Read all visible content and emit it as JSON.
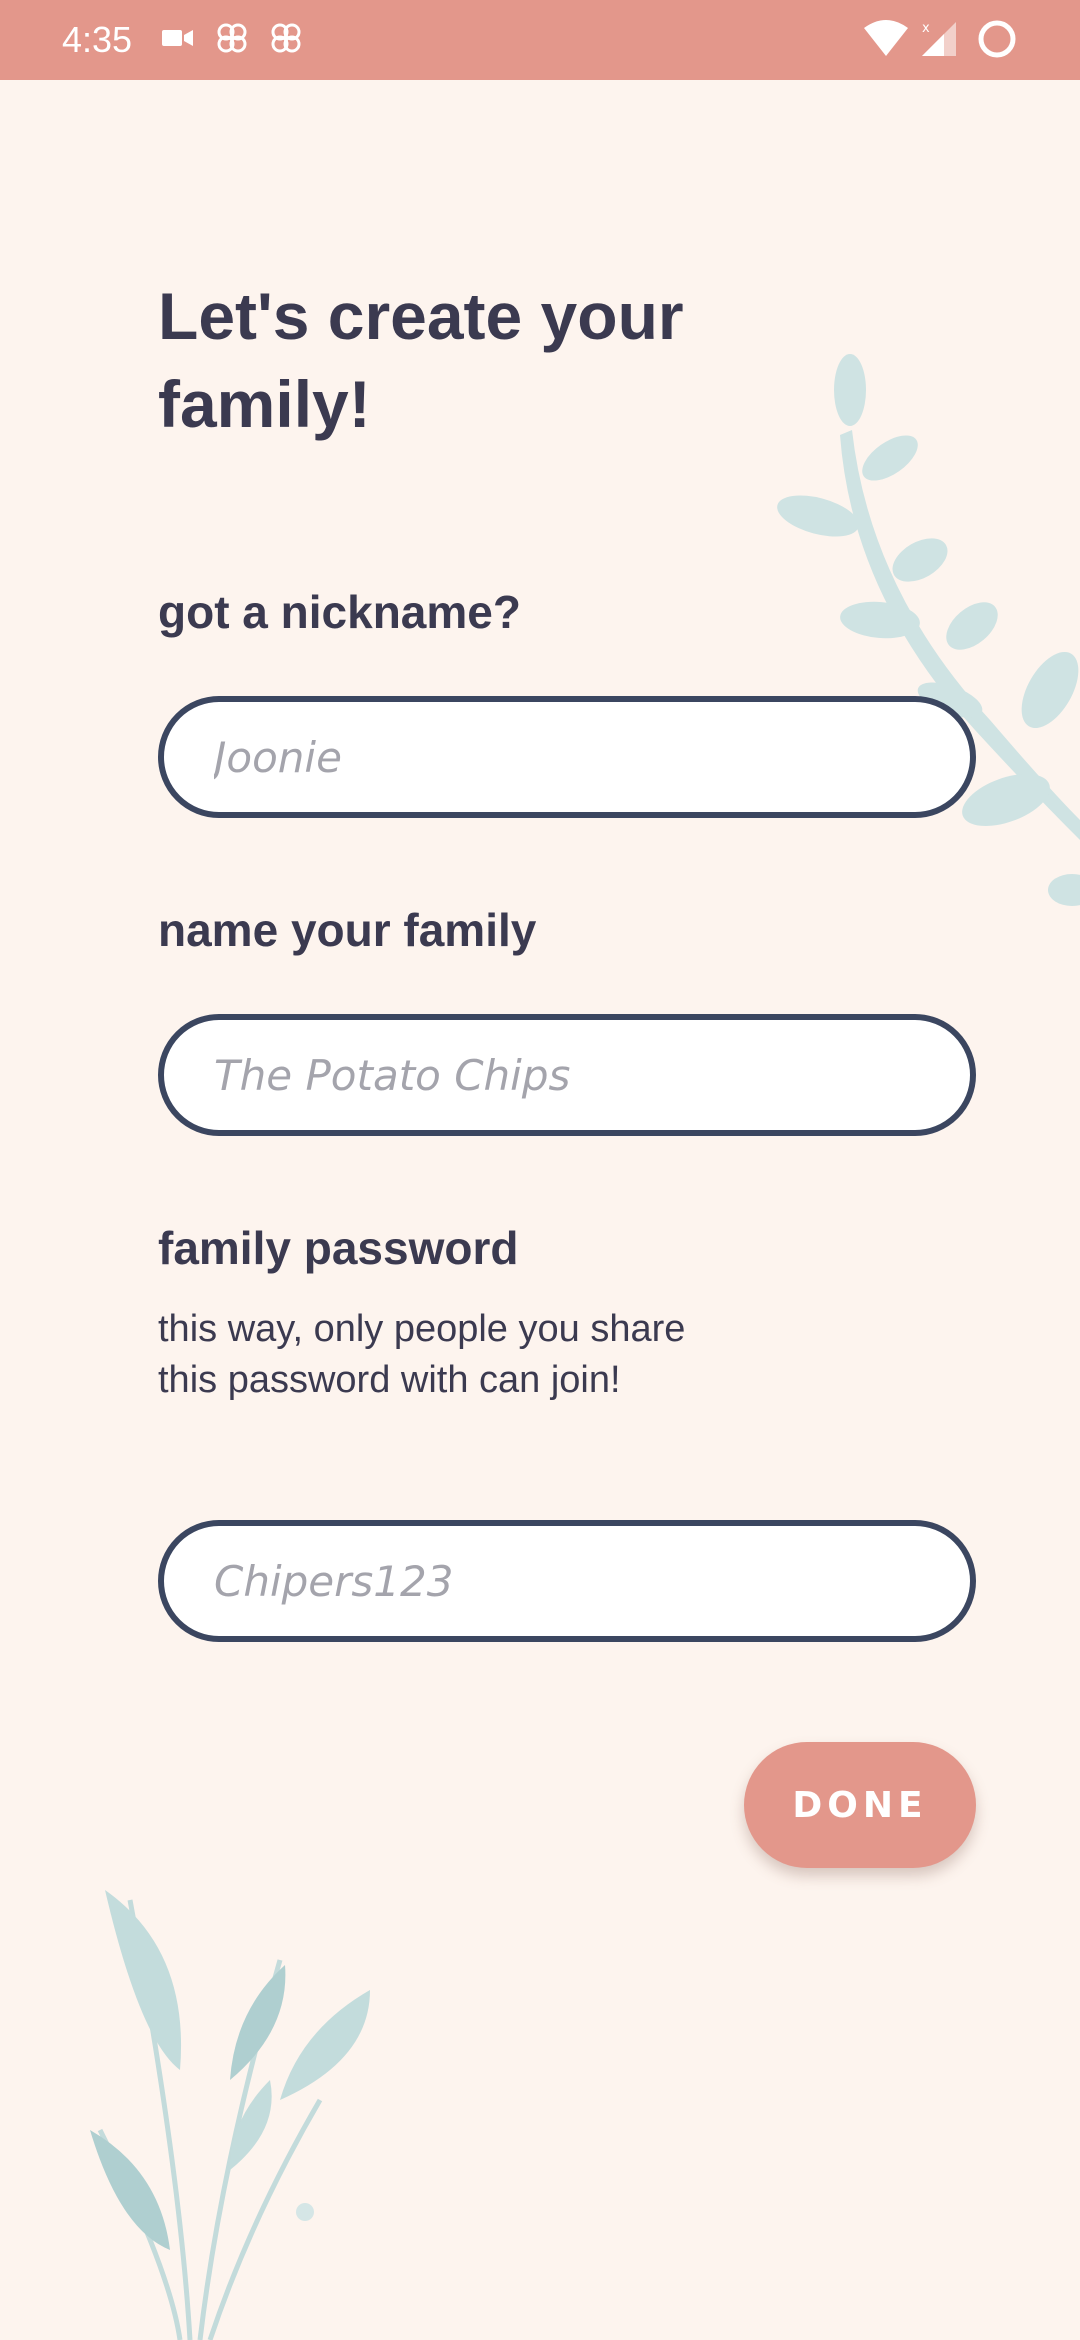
{
  "status_bar": {
    "time": "4:35",
    "icons": [
      "video-camera-icon",
      "fan-app-icon",
      "fan-app-icon",
      "wifi-icon",
      "signal-icon",
      "circle-status-icon"
    ]
  },
  "page": {
    "title": "Let's create your\nfamily!"
  },
  "form": {
    "nickname": {
      "label": "got a nickname?",
      "placeholder": "Joonie",
      "value": ""
    },
    "family_name": {
      "label": "name your family",
      "placeholder": "The Potato Chips",
      "value": ""
    },
    "password": {
      "label": "family password",
      "helper": "this way, only people you share this password with can join!",
      "placeholder": "Chipers123",
      "value": ""
    }
  },
  "actions": {
    "done_label": "DONE"
  },
  "colors": {
    "status_bar": "#e3978b",
    "background": "#fdf4ee",
    "text": "#3b3a50",
    "field_border": "#3b4660",
    "button": "#e3978b",
    "leaf": "#cfe3e3"
  }
}
